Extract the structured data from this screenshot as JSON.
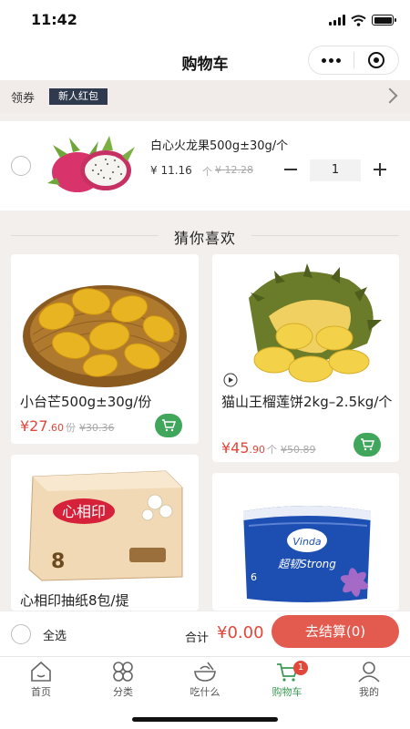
{
  "status_bar": {
    "time": "11:42"
  },
  "nav": {
    "title": "购物车"
  },
  "coupon": {
    "label": "领券",
    "tag": "新人红包"
  },
  "cart_item": {
    "name": "白心火龙果500g±30g/个",
    "price": "¥ 11.16",
    "unit": "个",
    "original_price": "¥ 12.28",
    "quantity": "1"
  },
  "recommend": {
    "title": "猜你喜欢",
    "products": [
      {
        "title": "小台芒500g±30g/份",
        "price_main": "¥27",
        "price_dec": ".60",
        "unit": "份",
        "original_price": "¥30.36"
      },
      {
        "title": "猫山王榴莲饼2kg–2.5kg/个",
        "price_main": "¥45",
        "price_dec": ".90",
        "unit": "个",
        "original_price": "¥50.89"
      },
      {
        "title": "心相印抽纸8包/提"
      }
    ],
    "image_texts": {
      "tissue_brand": "心相印",
      "vinda_brand": "Vinda",
      "vinda_tag": "超韧Strong"
    }
  },
  "checkout": {
    "select_all": "全选",
    "total_label": "合计",
    "total_value": "¥0.00",
    "button": "去结算(0)"
  },
  "tabs": [
    {
      "label": "首页",
      "icon": "home-icon"
    },
    {
      "label": "分类",
      "icon": "category-icon"
    },
    {
      "label": "吃什么",
      "icon": "bowl-icon"
    },
    {
      "label": "购物车",
      "icon": "cart-icon",
      "badge": "1",
      "active": true
    },
    {
      "label": "我的",
      "icon": "profile-icon"
    }
  ],
  "colors": {
    "accent_green": "#3fa65c",
    "price_red": "#e2473b",
    "checkout_red": "#e35a4f",
    "coupon_tag": "#2f3a4e"
  }
}
